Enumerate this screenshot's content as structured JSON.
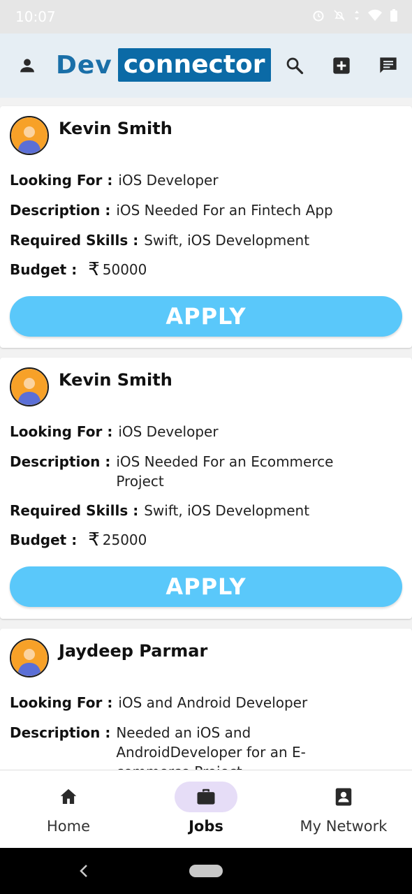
{
  "status_bar": {
    "time": "10:07"
  },
  "header": {
    "logo_part1": "Dev",
    "logo_part2": "connector",
    "icons": [
      "person-icon",
      "search-icon",
      "add-box-icon",
      "message-icon"
    ]
  },
  "labels": {
    "looking_for": "Looking For :",
    "description": "Description :",
    "required_skills": "Required Skills :",
    "budget": "Budget :",
    "currency_symbol": "₹",
    "apply": "APPLY"
  },
  "jobs": [
    {
      "name": "Kevin Smith",
      "looking_for": "iOS Developer",
      "description": "iOS Needed For an Fintech App",
      "skills": "Swift, iOS Development",
      "budget": "50000"
    },
    {
      "name": "Kevin Smith",
      "looking_for": "iOS Developer",
      "description": "iOS Needed For an Ecommerce Project",
      "skills": "Swift, iOS Development",
      "budget": "25000"
    },
    {
      "name": "Jaydeep Parmar",
      "looking_for": "iOS and Android Developer",
      "description": "Needed an iOS and AndroidDeveloper for an E-commerce Project"
    }
  ],
  "bottom_nav": [
    {
      "label": "Home",
      "icon": "home-icon",
      "active": false
    },
    {
      "label": "Jobs",
      "icon": "briefcase-icon",
      "active": true
    },
    {
      "label": "My Network",
      "icon": "contact-card-icon",
      "active": false
    }
  ],
  "colors": {
    "accent_blue": "#0b6aa6",
    "apply_button": "#5ac8fa",
    "active_nav_pill": "#e6ddf7"
  }
}
